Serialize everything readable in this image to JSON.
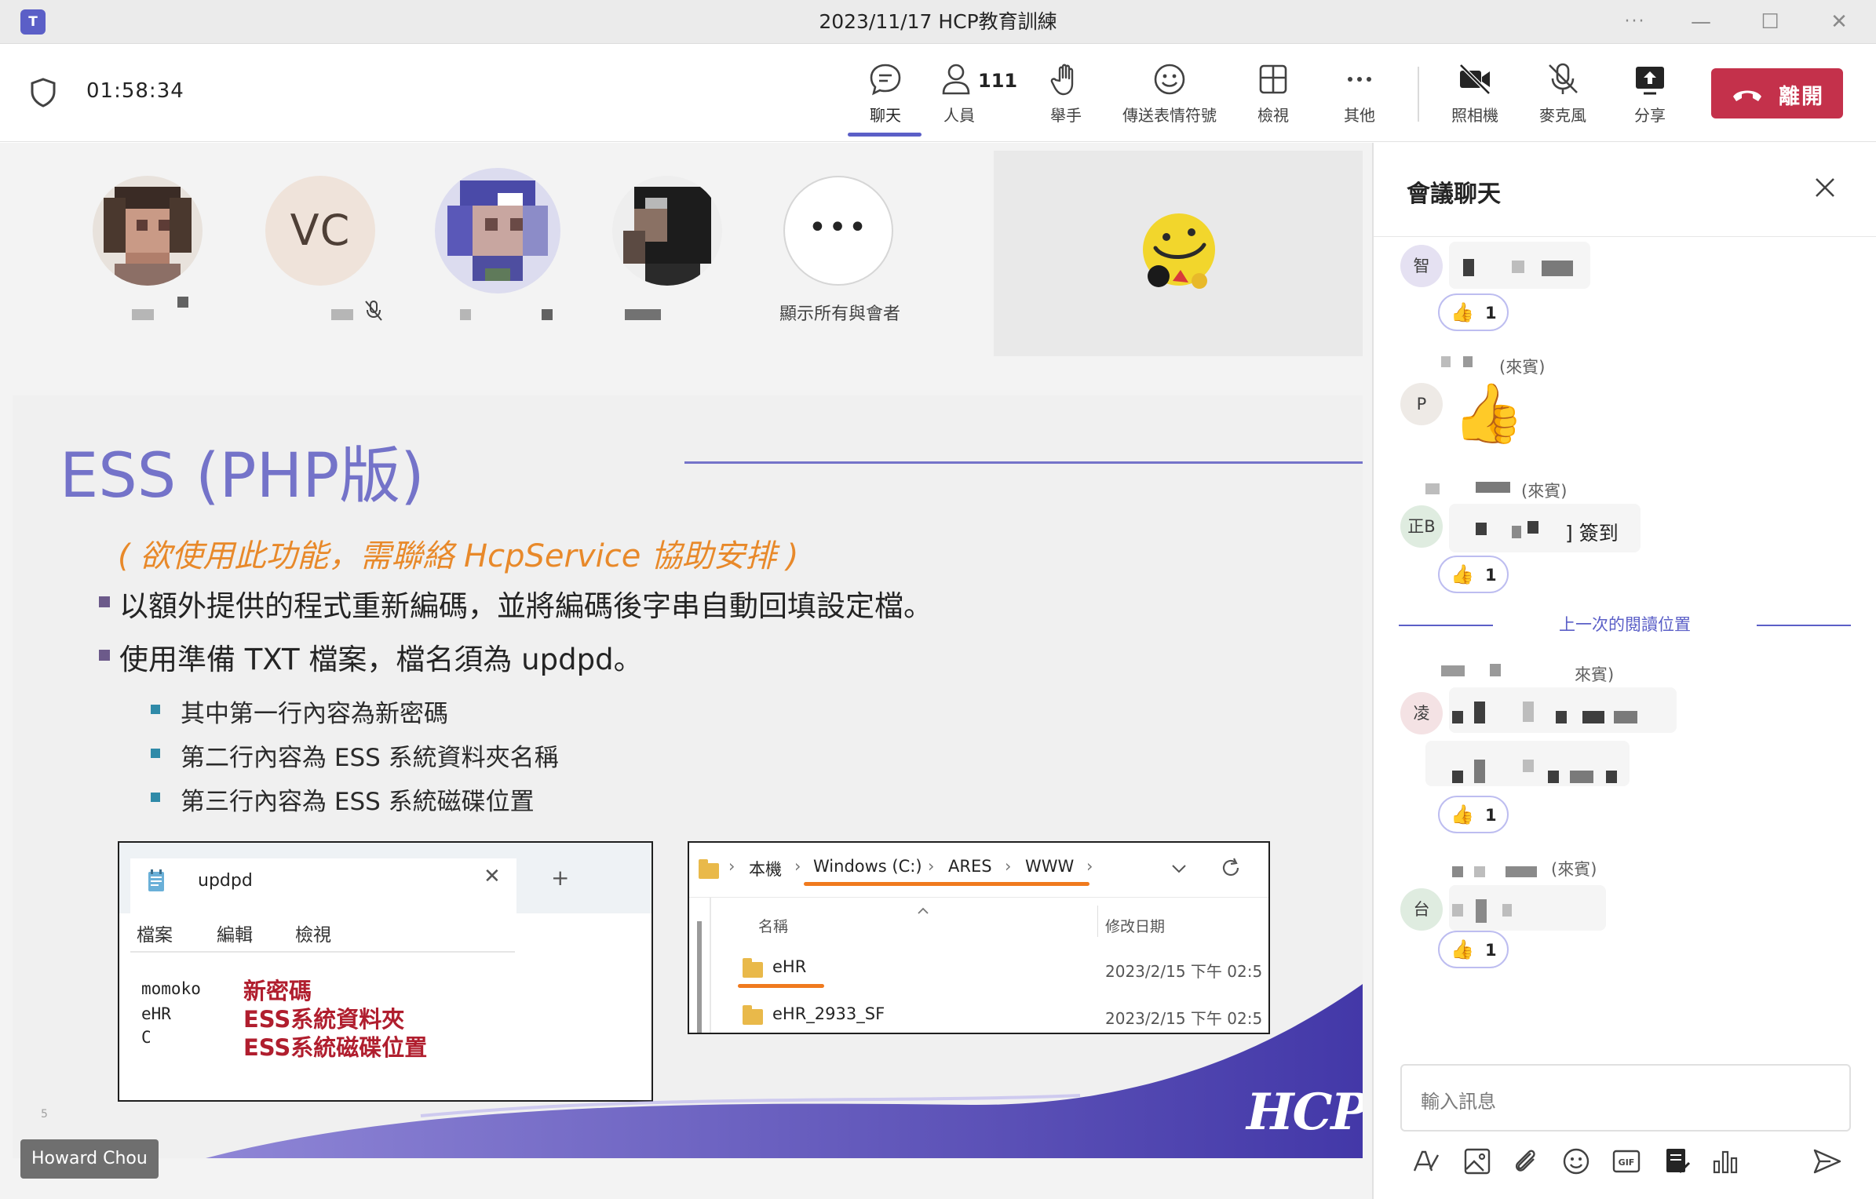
{
  "window": {
    "title": "2023/11/17 HCP教育訓練",
    "app_icon": "teams-logo-icon",
    "app_icon_text": "T",
    "more_label": "···",
    "minimize_label": "—",
    "maximize_label": "☐",
    "close_label": "✕"
  },
  "toolbar": {
    "timer": "01:58:34",
    "chat_label": "聊天",
    "people_label": "人員",
    "people_count": "111",
    "raise_hand_label": "舉手",
    "reactions_label": "傳送表情符號",
    "view_label": "檢視",
    "more_label": "其他",
    "camera_label": "照相機",
    "mic_label": "麥克風",
    "share_label": "分享",
    "leave_label": "離開",
    "accent_color": "#5b5fc7",
    "leave_color": "#c4314b"
  },
  "participants": {
    "vc_initials": "VC",
    "more_glyph": "•••",
    "show_all_label": "顯示所有與會者"
  },
  "slide": {
    "title": "ESS (PHP版)",
    "note": "( 欲使用此功能，需聯絡 HcpService 協助安排 )",
    "bullet_1": "以額外提供的程式重新編碼，並將編碼後字串自動回填設定檔。",
    "bullet_2": "使用準備 TXT 檔案，檔名須為 updpd。",
    "sub_1": "其中第一行內容為新密碼",
    "sub_2": "第二行內容為 ESS 系統資料夾名稱",
    "sub_3": "第三行內容為 ESS 系統磁碟位置",
    "page_number": "5",
    "notepad": {
      "tab_name": "updpd",
      "close": "✕",
      "plus": "+",
      "menu_file": "檔案",
      "menu_edit": "編輯",
      "menu_view": "檢視",
      "line_1": "momoko",
      "line_2": "eHR",
      "line_3": "C",
      "label_1": "新密碼",
      "label_2": "ESS系統資料夾",
      "label_3": "ESS系統磁碟位置"
    },
    "explorer": {
      "crumb_1": "本機",
      "crumb_2": "Windows (C:)",
      "crumb_3": "ARES",
      "crumb_4": "WWW",
      "sep": "›",
      "col_name": "名稱",
      "col_date": "修改日期",
      "row_1_name": "eHR",
      "row_1_date": "2023/2/15 下午 02:5",
      "row_2_name": "eHR_2933_SF",
      "row_2_date": "2023/2/15 下午 02:5"
    },
    "logo_text": "HCP",
    "title_color": "#7473c9",
    "note_color": "#e8892a"
  },
  "presenter_name": "Howard Chou",
  "chat": {
    "title": "會議聊天",
    "messages": [
      {
        "avatar": "智",
        "reaction_count": "1"
      },
      {
        "avatar": "P",
        "guest_tag": "(來賓)",
        "emoji": "👍"
      },
      {
        "avatar": "正B",
        "guest_tag": "(來賓)",
        "text_tail": "] 簽到",
        "reaction_count": "1"
      },
      {
        "avatar": "凌",
        "guest_tag": "來賓)",
        "reaction_count": "1"
      },
      {
        "avatar": "台",
        "guest_tag": "(來賓)",
        "reaction_count": "1"
      }
    ],
    "last_read_label": "上一次的閱讀位置",
    "composer_placeholder": "輸入訊息",
    "thumb": "👍"
  }
}
